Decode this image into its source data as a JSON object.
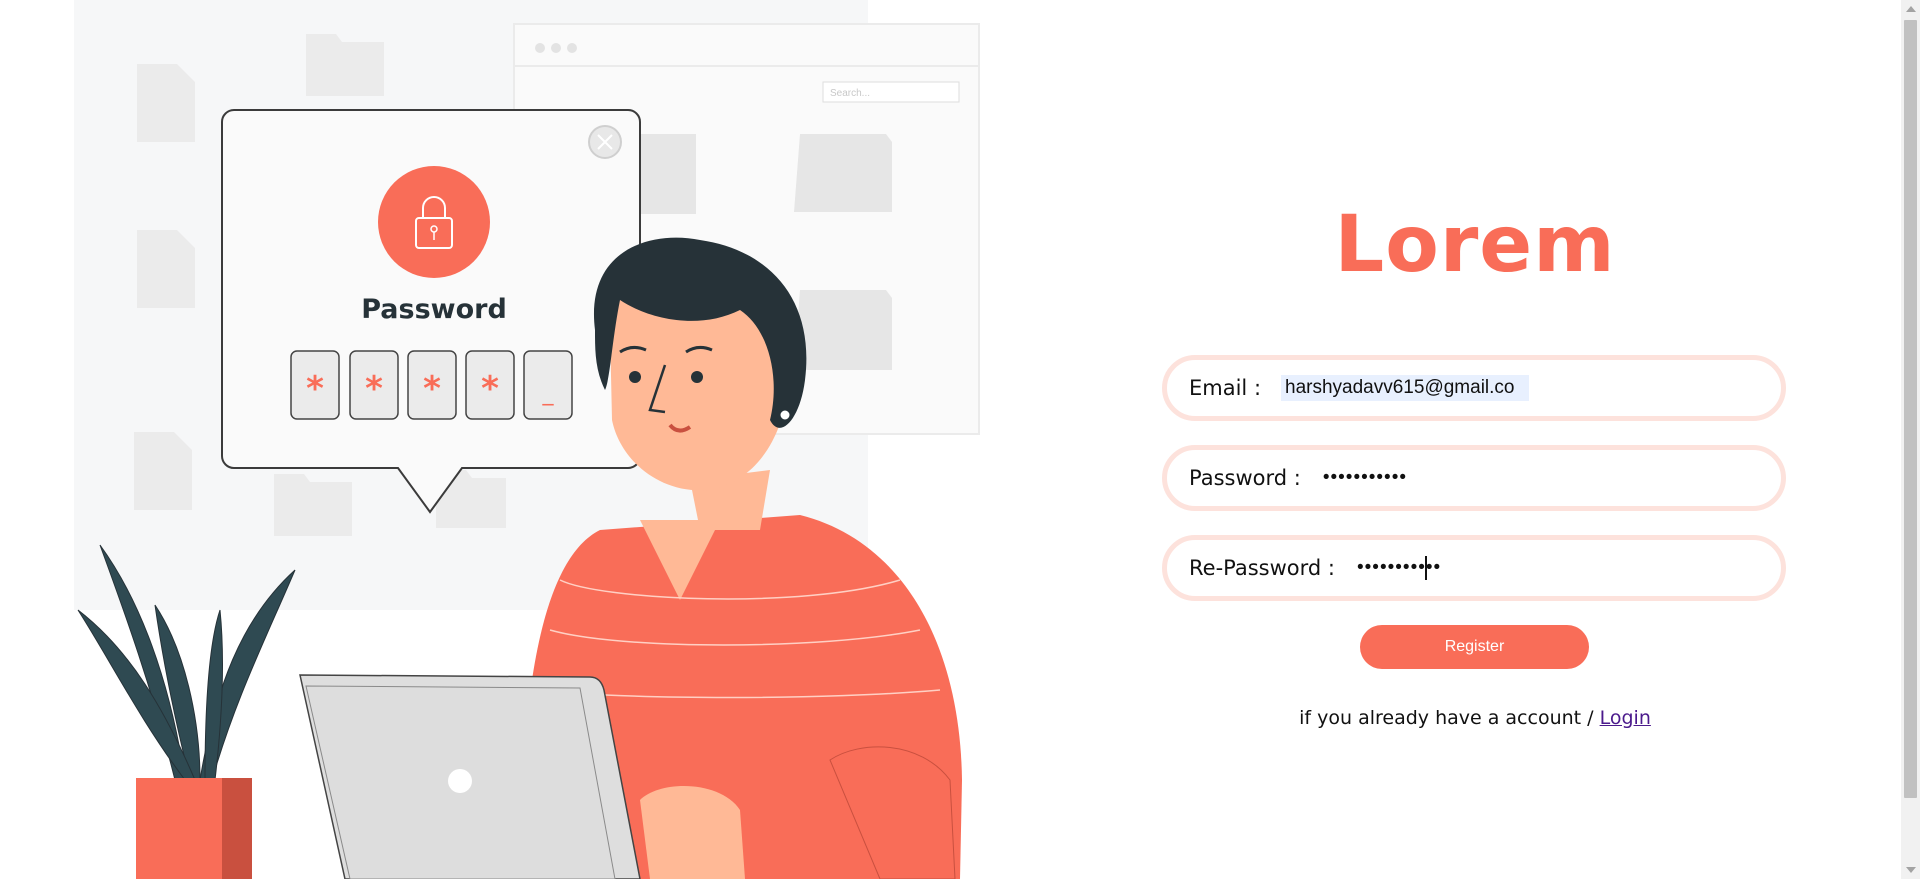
{
  "brand": {
    "title": "Lorem",
    "color": "#f96d58"
  },
  "illustration": {
    "popup_title": "Password",
    "pin_chars": [
      "*",
      "*",
      "*",
      "*",
      "_"
    ],
    "search_placeholder": "Search..."
  },
  "form": {
    "email": {
      "label": "Email :",
      "value": "harshyadavv615@gmail.co"
    },
    "password": {
      "label": "Password :",
      "value": "•••••••••••"
    },
    "repassword": {
      "label": "Re-Password :",
      "value": "•••••••••••"
    },
    "register_label": "Register",
    "login_prompt": "if you already have a account /",
    "login_link": "Login"
  },
  "colors": {
    "accent": "#f96d58",
    "field_border": "#fde2dc",
    "link": "#4b1a8c"
  }
}
